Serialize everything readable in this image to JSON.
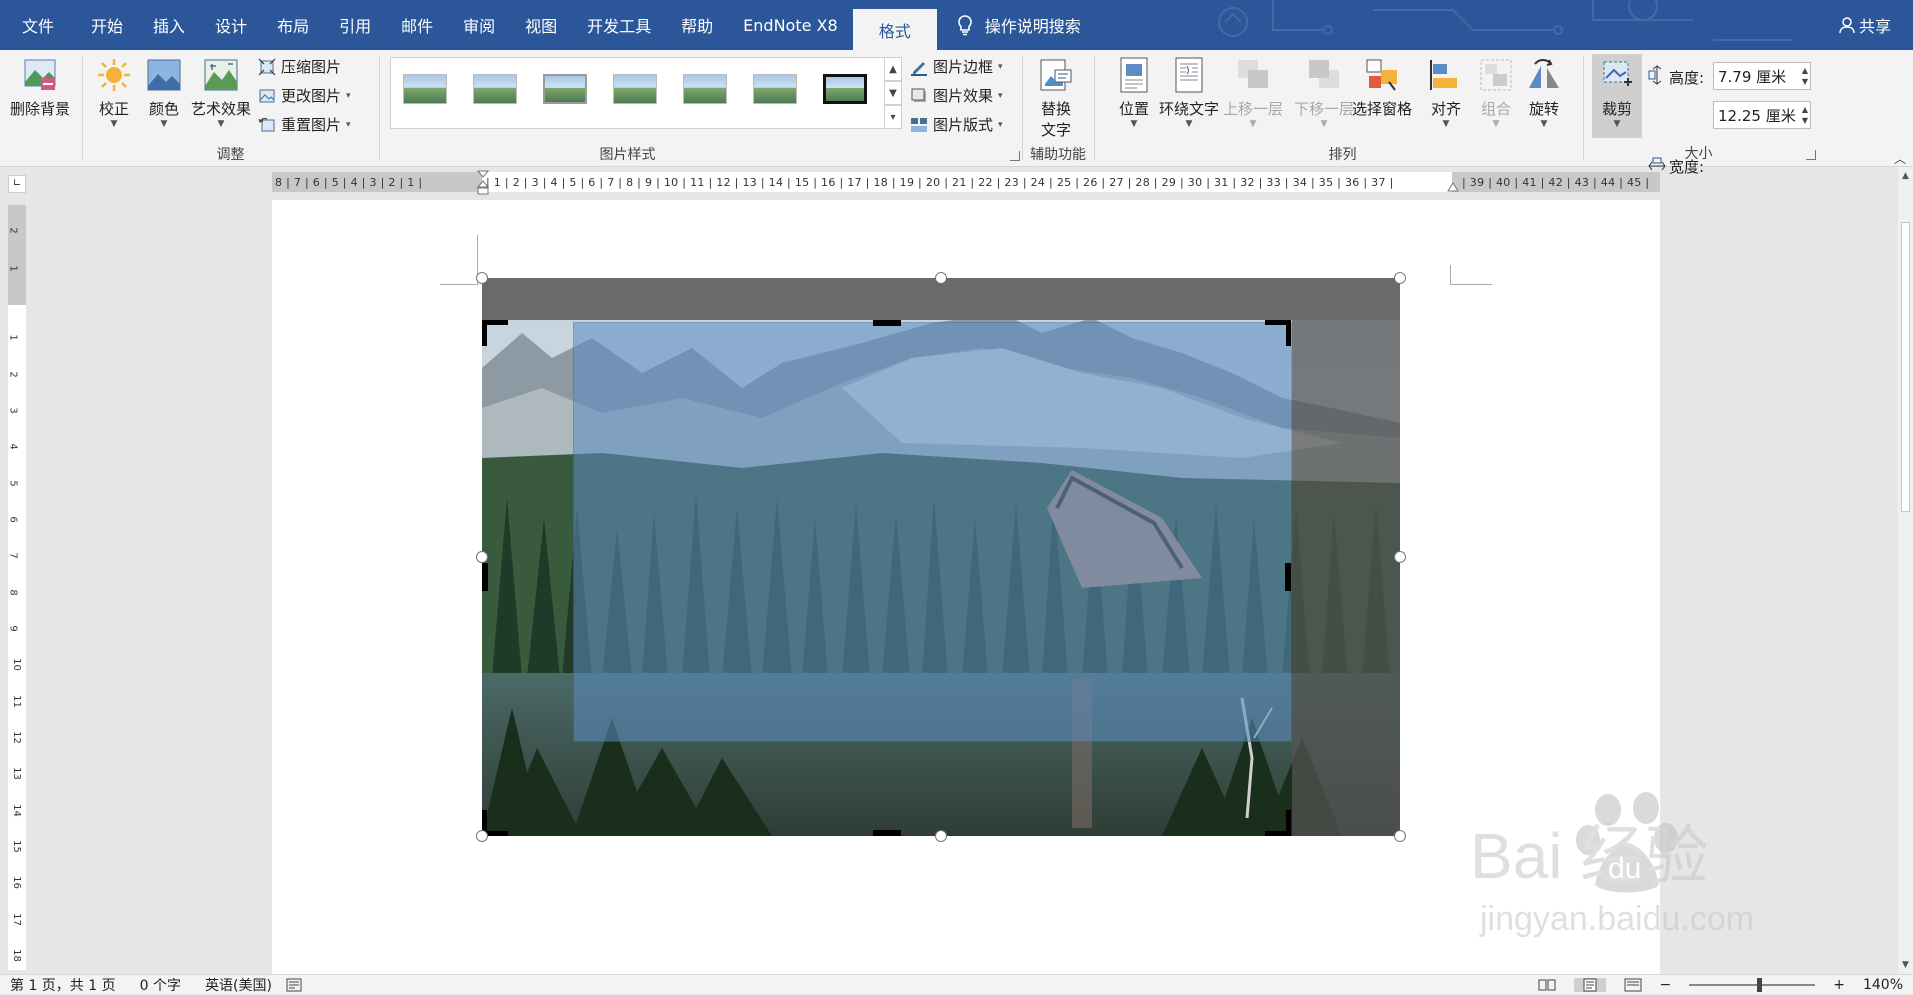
{
  "tabs": [
    {
      "label": "文件"
    },
    {
      "label": "开始"
    },
    {
      "label": "插入"
    },
    {
      "label": "设计"
    },
    {
      "label": "布局"
    },
    {
      "label": "引用"
    },
    {
      "label": "邮件"
    },
    {
      "label": "审阅"
    },
    {
      "label": "视图"
    },
    {
      "label": "开发工具"
    },
    {
      "label": "帮助"
    },
    {
      "label": "EndNote X8"
    },
    {
      "label": "格式"
    }
  ],
  "tell_me": "操作说明搜索",
  "share_label": "共享",
  "ribbon": {
    "remove_bg": "删除背景",
    "adjust": {
      "label": "调整",
      "correct": "校正",
      "color": "颜色",
      "art": "艺术效果",
      "compress": "压缩图片",
      "change": "更改图片",
      "reset": "重置图片"
    },
    "styles": {
      "label": "图片样式",
      "border": "图片边框",
      "effects": "图片效果",
      "layout": "图片版式"
    },
    "accessibility": {
      "label": "辅助功能",
      "alt_text_line1": "替换",
      "alt_text_line2": "文字"
    },
    "arrange": {
      "label": "排列",
      "position": "位置",
      "wrap": "环绕文字",
      "forward": "上移一层",
      "backward": "下移一层",
      "pane": "选择窗格",
      "align": "对齐",
      "group": "组合",
      "rotate": "旋转"
    },
    "size": {
      "label": "大小",
      "crop": "裁剪",
      "height_label": "高度:",
      "height_value": "7.79 厘米",
      "width_label": "宽度:",
      "width_value": "12.25 厘米"
    }
  },
  "ruler": {
    "h_left": "8 | 7 | 6 | 5 | 4 | 3 | 2 | 1 |",
    "h_main": "| 1 | 2 | 3 | 4 | 5 | 6 | 7 | 8 | 9 | 10 | 11 | 12 | 13 | 14 | 15 | 16 | 17 | 18 | 19 | 20 | 21 | 22 | 23 | 24 | 25 | 26 | 27 | 28 | 29 | 30 | 31 | 32 | 33 | 34 | 35 | 36 | 37 |",
    "h_right": "| 39 | 40 | 41 | 42 | 43 | 44 | 45 |",
    "v_top": [
      "2",
      "1"
    ],
    "v_main": [
      "1",
      "2",
      "3",
      "4",
      "5",
      "6",
      "7",
      "8",
      "9",
      "10",
      "11",
      "12",
      "13",
      "14",
      "15",
      "16",
      "17",
      "18"
    ]
  },
  "status": {
    "page": "第 1 页，共 1 页",
    "words": "0 个字",
    "lang": "英语(美国)",
    "zoom": "140%",
    "zoom_minus": "−",
    "zoom_plus": "+"
  },
  "watermark": {
    "brand": "Bai 经验",
    "paw_text": "du",
    "url": "jingyan.baidu.com"
  },
  "colors": {
    "title_bar": "#2b579a",
    "ribbon_bg": "#f3f3f3",
    "crop_overlay": "#5b8cc2"
  }
}
